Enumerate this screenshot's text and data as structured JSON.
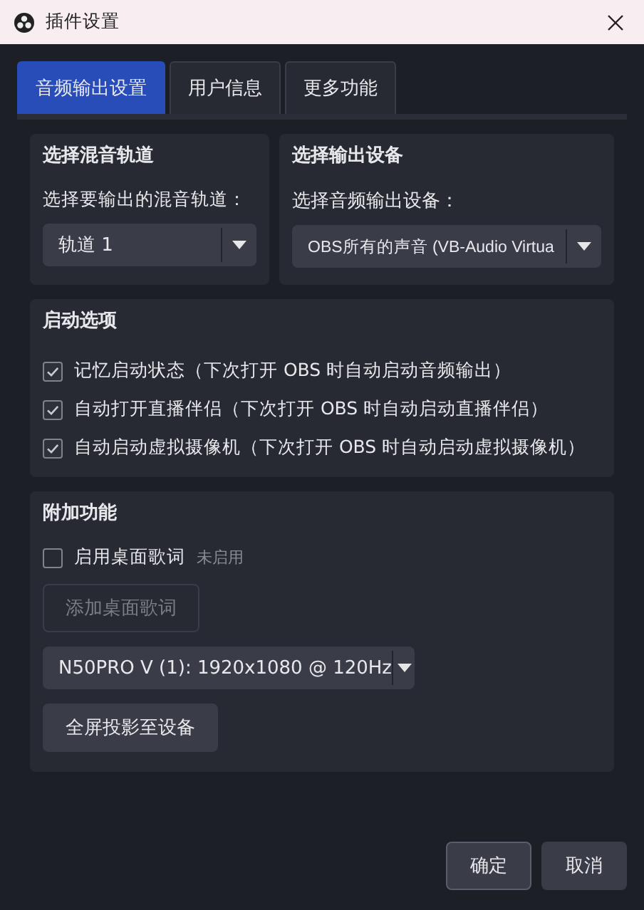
{
  "window": {
    "title": "插件设置"
  },
  "tabs": [
    {
      "label": "音频输出设置",
      "selected": true
    },
    {
      "label": "用户信息",
      "selected": false
    },
    {
      "label": "更多功能",
      "selected": false
    }
  ],
  "mix_track": {
    "heading": "选择混音轨道",
    "label": "选择要输出的混音轨道：",
    "value": "轨道 1"
  },
  "output_device": {
    "heading": "选择输出设备",
    "label": "选择音频输出设备：",
    "value": "OBS所有的声音 (VB-Audio Virtua"
  },
  "startup_options": {
    "heading": "启动选项",
    "items": [
      {
        "label": "记忆启动状态（下次打开 OBS 时自动启动音频输出）",
        "checked": true
      },
      {
        "label": "自动打开直播伴侣（下次打开 OBS 时自动启动直播伴侣）",
        "checked": true
      },
      {
        "label": "自动启动虚拟摄像机（下次打开 OBS 时自动启动虚拟摄像机）",
        "checked": true
      }
    ]
  },
  "extras": {
    "heading": "附加功能",
    "lyrics_toggle": {
      "label": "启用桌面歌词",
      "checked": false,
      "status": "未启用"
    },
    "add_lyrics_button": {
      "label": "添加桌面歌词",
      "disabled": true
    },
    "display": {
      "value": "N50PRO V (1): 1920x1080 @ 120Hz"
    },
    "project_button": {
      "label": "全屏投影至设备",
      "disabled": false
    }
  },
  "buttons": [
    {
      "label": "确定",
      "kind": "default"
    },
    {
      "label": "取消",
      "kind": "normal"
    }
  ]
}
